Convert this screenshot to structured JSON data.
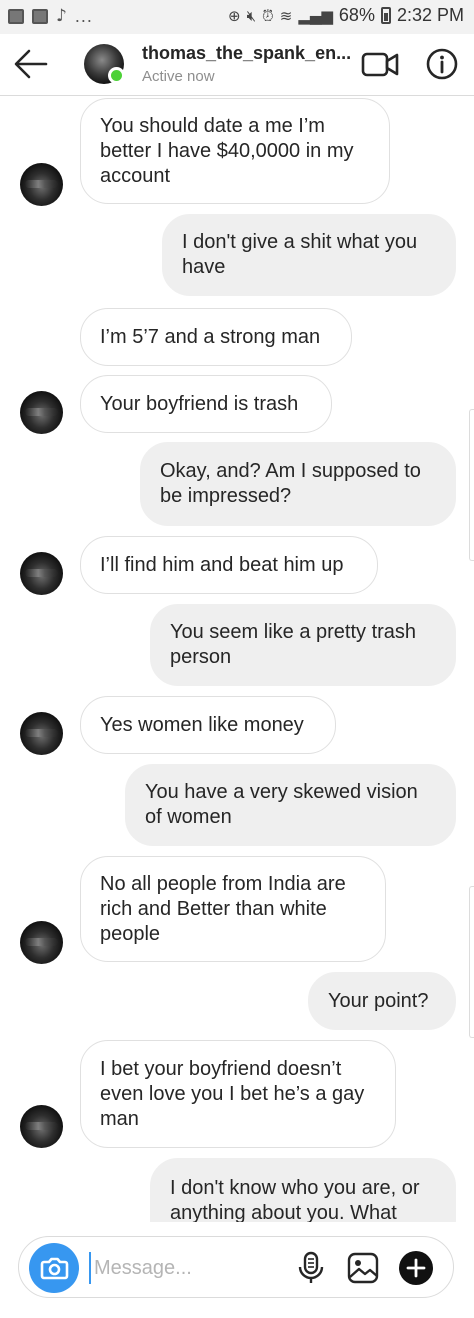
{
  "status_bar": {
    "dots": "...",
    "battery": "68%",
    "time": "2:32 PM"
  },
  "header": {
    "username": "thomas_the_spank_en...",
    "status": "Active now",
    "back_icon": "arrow-left-icon",
    "video_icon": "video-camera-icon",
    "info_icon": "info-icon",
    "online_color": "#4cd137"
  },
  "messages": [
    {
      "side": "in",
      "text": "You should date a me I’m better I have $40,0000 in my account"
    },
    {
      "side": "out",
      "text": "I don't give a shit what you have"
    },
    {
      "side": "in",
      "text": "I’m 5’7 and a strong man"
    },
    {
      "side": "in",
      "text": "Your boyfriend is trash"
    },
    {
      "side": "out",
      "text": "Okay, and? Am I supposed to be impressed?"
    },
    {
      "side": "in",
      "text": "I’ll find him and beat him up"
    },
    {
      "side": "out",
      "text": "You seem like a pretty trash person"
    },
    {
      "side": "in",
      "text": "Yes women like money"
    },
    {
      "side": "out",
      "text": "You have a very skewed vision of women"
    },
    {
      "side": "in",
      "text": "No all people from India are rich and Better than white people"
    },
    {
      "side": "out",
      "text": "Your point?"
    },
    {
      "side": "in",
      "text": "I bet your boyfriend doesn’t even love you I bet he’s a gay man"
    },
    {
      "side": "out",
      "text": "I don't know who you are, or anything about you. What"
    }
  ],
  "composer": {
    "placeholder": "Message...",
    "camera_icon": "camera-icon",
    "mic_icon": "microphone-icon",
    "gallery_icon": "image-gallery-icon",
    "plus_icon": "plus-icon",
    "accent_color": "#3797f0"
  }
}
